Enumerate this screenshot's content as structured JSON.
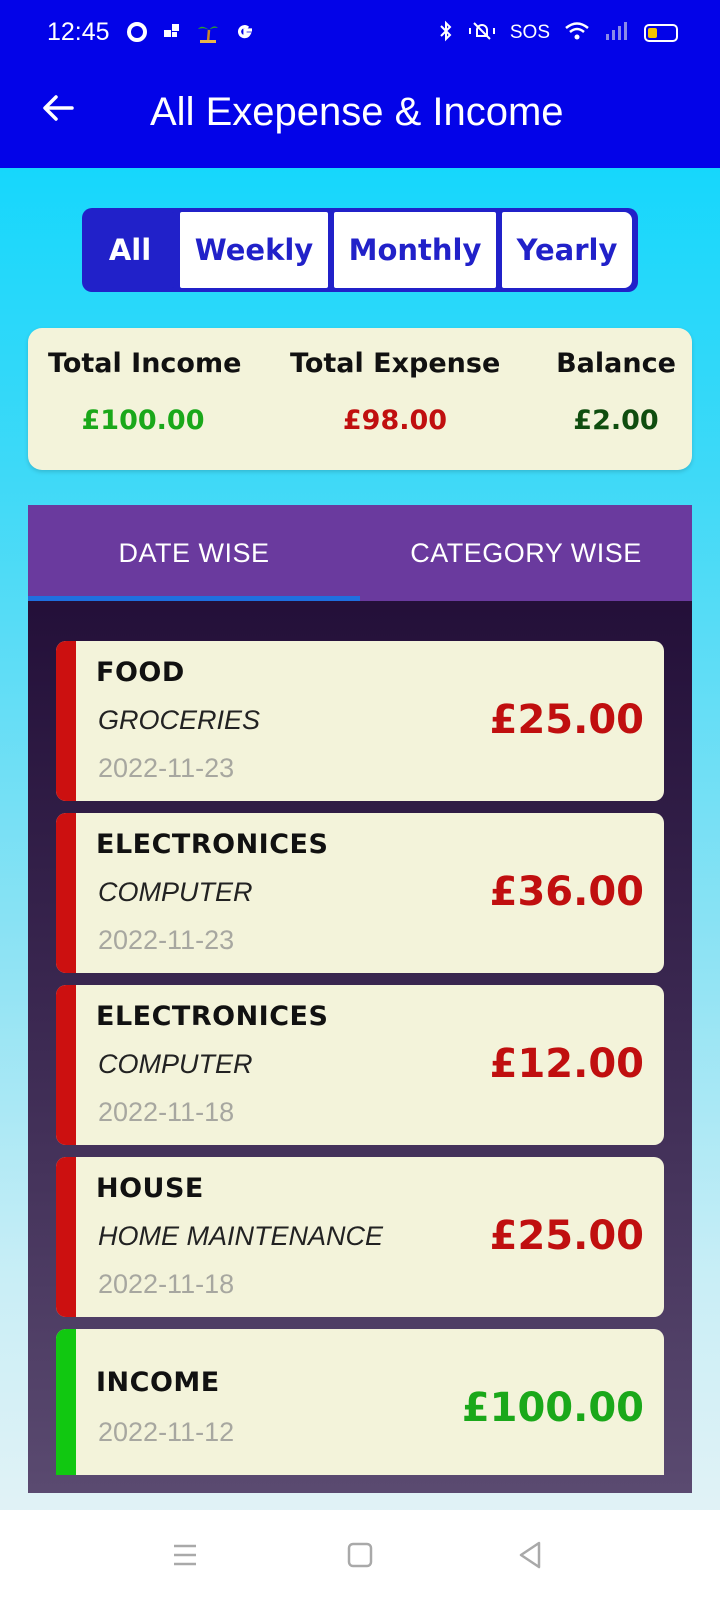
{
  "status_bar": {
    "time": "12:45",
    "sos": "SOS"
  },
  "app_bar": {
    "title": "All Exepense & Income"
  },
  "filter": {
    "options": [
      "All",
      "Weekly",
      "Monthly",
      "Yearly"
    ],
    "selected": "All"
  },
  "summary": {
    "income_label": "Total Income",
    "income_value": "£100.00",
    "expense_label": "Total Expense",
    "expense_value": "£98.00",
    "balance_label": "Balance",
    "balance_value": "£2.00"
  },
  "tabs": {
    "items": [
      "DATE WISE",
      "CATEGORY WISE"
    ],
    "selected": "DATE WISE"
  },
  "transactions": [
    {
      "category": "FOOD",
      "subcategory": "GROCERIES",
      "date": "2022-11-23",
      "amount": "£25.00",
      "type": "expense"
    },
    {
      "category": "ELECTRONICES",
      "subcategory": "COMPUTER",
      "date": "2022-11-23",
      "amount": "£36.00",
      "type": "expense"
    },
    {
      "category": "ELECTRONICES",
      "subcategory": "COMPUTER",
      "date": "2022-11-18",
      "amount": "£12.00",
      "type": "expense"
    },
    {
      "category": "HOUSE",
      "subcategory": "HOME MAINTENANCE",
      "date": "2022-11-18",
      "amount": "£25.00",
      "type": "expense"
    },
    {
      "category": "INCOME",
      "subcategory": "",
      "date": "2022-11-12",
      "amount": "£100.00",
      "type": "income"
    }
  ],
  "colors": {
    "app_bar": "#0303e8",
    "accent": "#2121c9",
    "income_green": "#1aa81a",
    "expense_red": "#c00f0f",
    "balance_green": "#0f4d0f",
    "expense_stripe": "#cc1010",
    "income_stripe": "#11c811",
    "tab_bar": "#6a3a9e",
    "tab_indicator": "#1f6fe0",
    "card_bg": "#f3f3da"
  },
  "icons": {
    "back": "arrow-left-icon",
    "nav_recents": "menu-lines-icon",
    "nav_home": "square-icon",
    "nav_back": "triangle-back-icon"
  }
}
